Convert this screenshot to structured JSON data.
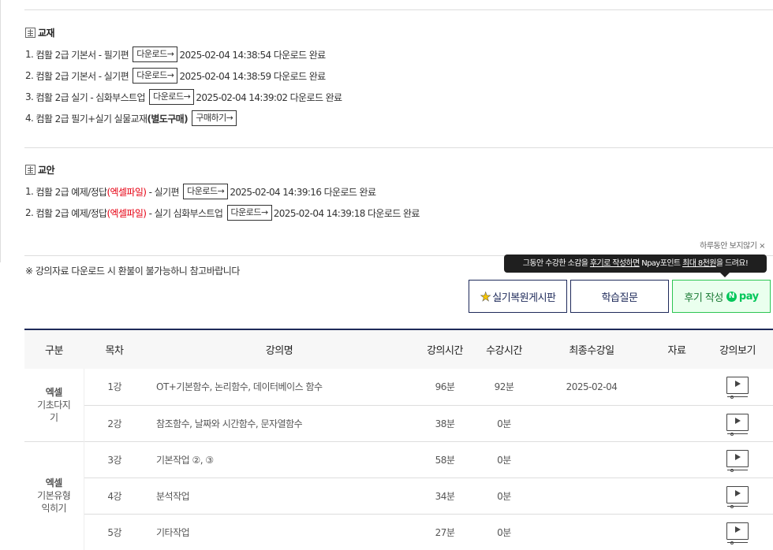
{
  "textbook": {
    "title": "교재",
    "items": [
      {
        "num": "1.",
        "name": "컴활 2급 기본서 - 필기편",
        "button": "다운로드→",
        "status": "2025-02-04 14:38:54 다운로드 완료"
      },
      {
        "num": "2.",
        "name": "컴활 2급 기본서 - 실기편",
        "button": "다운로드→",
        "status": "2025-02-04 14:38:59 다운로드 완료"
      },
      {
        "num": "3.",
        "name": "컴활 2급 실기 - 심화부스트업",
        "button": "다운로드→",
        "status": "2025-02-04 14:39:02 다운로드 완료"
      },
      {
        "num": "4.",
        "name": "컴활 2급 필기+실기 실물교재",
        "bold": "(별도구매)",
        "button": "구매하기→"
      }
    ]
  },
  "lessonplan": {
    "title": "교안",
    "items": [
      {
        "num": "1.",
        "name_pre": "컴활 2급 예제/정답",
        "red": "(엑셀파일)",
        "name_post": " - 실기편",
        "button": "다운로드→",
        "status": "2025-02-04 14:39:16 다운로드 완료"
      },
      {
        "num": "2.",
        "name_pre": "컴활 2급 예제/정답",
        "red": "(엑셀파일)",
        "name_post": " - 실기 심화부스트업",
        "button": "다운로드→",
        "status": "2025-02-04 14:39:18 다운로드 완료"
      }
    ]
  },
  "close_tip": "하루동안 보지않기 ×",
  "notice": "※ 강의자료 다운로드 시 환불이 불가능하니 참고바랍니다",
  "tooltip": {
    "pre": "그동안 수강한 소감을 ",
    "u1": "후기로 작성하면",
    "mid": " Npay포인트 ",
    "u2": "최대 8천원",
    "post": "을 드려요!"
  },
  "buttons": {
    "board": "실기복원게시판",
    "question": "학습질문",
    "review": "후기 작성",
    "npay": "pay",
    "npay_n": "N"
  },
  "table": {
    "headers": [
      "구분",
      "목차",
      "강의명",
      "강의시간",
      "수강시간",
      "최종수강일",
      "자료",
      "강의보기"
    ],
    "groups": [
      {
        "bold": "엑셀",
        "sub": "기초다지기",
        "sub_wrap": [
          "기초다지",
          "기"
        ]
      },
      {
        "bold": "엑셀",
        "sub_wrap": [
          "기본유형",
          "익히기"
        ]
      }
    ],
    "rows": [
      {
        "no": "1강",
        "title": "OT+기본함수, 논리함수, 데이터베이스 함수",
        "len": "96분",
        "watched": "92분",
        "last": "2025-02-04",
        "res": ""
      },
      {
        "no": "2강",
        "title": "참조함수, 날짜와 시간함수, 문자열함수",
        "len": "38분",
        "watched": "0분",
        "last": "",
        "res": ""
      },
      {
        "no": "3강",
        "title": "기본작업 ②, ③",
        "len": "58분",
        "watched": "0분",
        "last": "",
        "res": ""
      },
      {
        "no": "4강",
        "title": "분석작업",
        "len": "34분",
        "watched": "0분",
        "last": "",
        "res": ""
      },
      {
        "no": "5강",
        "title": "기타작업",
        "len": "27분",
        "watched": "0분",
        "last": "",
        "res": ""
      }
    ]
  }
}
